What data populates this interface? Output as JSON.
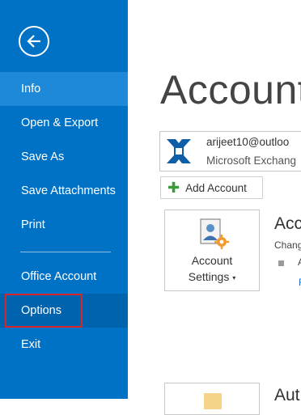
{
  "sidebar": {
    "back_label": "Back",
    "items": [
      {
        "label": "Info"
      },
      {
        "label": "Open & Export"
      },
      {
        "label": "Save As"
      },
      {
        "label": "Save Attachments"
      },
      {
        "label": "Print"
      },
      {
        "label": "Office Account"
      },
      {
        "label": "Options"
      },
      {
        "label": "Exit"
      }
    ],
    "selected": "Info",
    "highlighted": "Options"
  },
  "main": {
    "title": "Account",
    "account_selector": {
      "email": "arijeet10@outloo",
      "type": "Microsoft Exchang"
    },
    "add_account_label": "Add Account",
    "account_settings": {
      "label_line1": "Account",
      "label_line2": "Settings",
      "heading": "Acc",
      "description": "Chang",
      "bullet": "A",
      "link": "F"
    },
    "auto_section": {
      "heading": "Aut"
    }
  },
  "colors": {
    "sidebar_bg": "#0072c6",
    "sidebar_selected": "#1d89d8",
    "highlight_border": "#d5262e",
    "add_icon": "#3a9b3a",
    "link": "#2a6fc9"
  },
  "icons": {
    "back": "back-arrow-icon",
    "account": "exchange-icon",
    "add": "plus-icon",
    "settings": "account-settings-icon"
  }
}
